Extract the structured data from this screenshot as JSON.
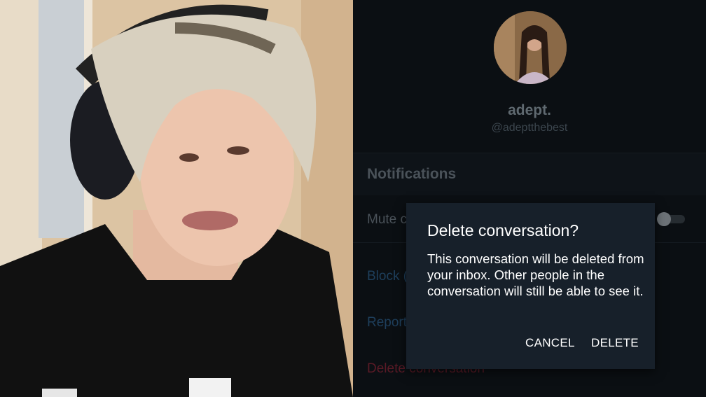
{
  "profile": {
    "display_name": "adept.",
    "handle": "@adeptthebest"
  },
  "settings": {
    "notifications_title": "Notifications",
    "mute_label": "Mute c",
    "mute_enabled": false,
    "block_label": "Block (",
    "report_label": "Report",
    "delete_conversation_label": "Delete conversation"
  },
  "dialog": {
    "title": "Delete conversation?",
    "body": "This conversation will be deleted from your inbox. Other people in the conversation will still be able to see it.",
    "cancel_label": "CANCEL",
    "delete_label": "DELETE"
  },
  "colors": {
    "phone_background": "#0b0f13",
    "dialog_background": "#17202a",
    "link_blue": "#1e3f5c",
    "danger_red": "#5a1a26"
  }
}
